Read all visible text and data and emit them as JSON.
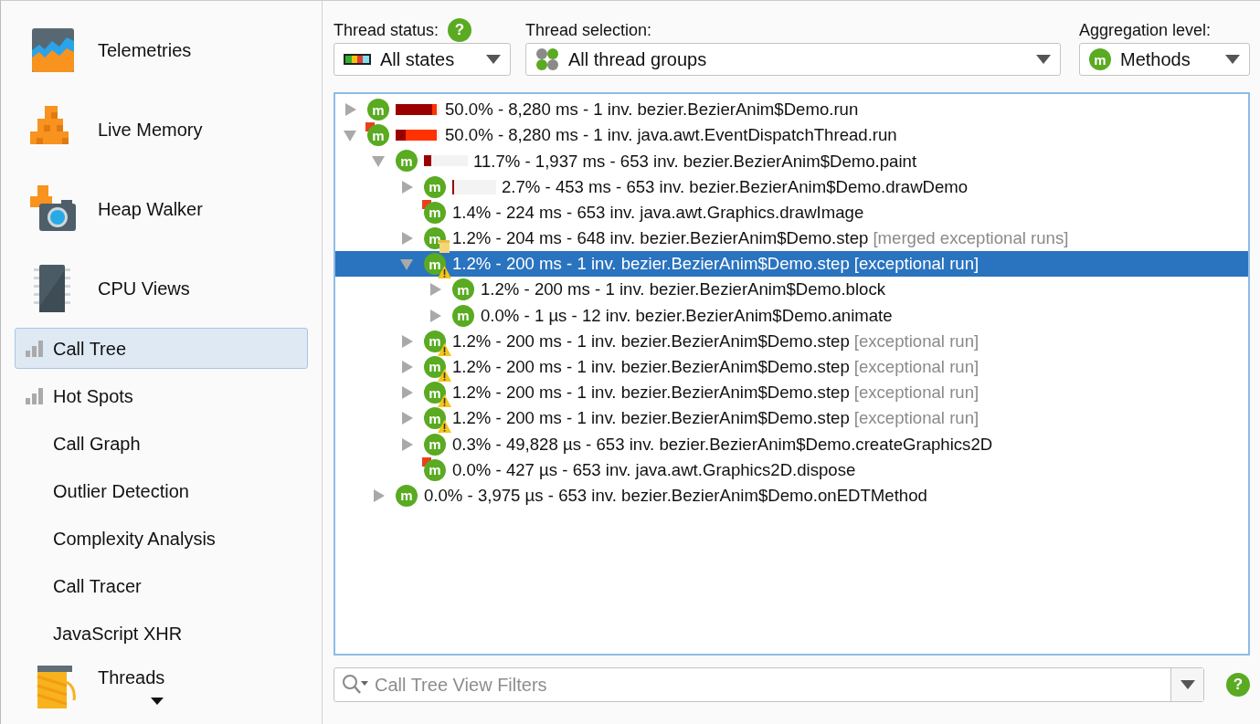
{
  "sidebar": {
    "items": [
      {
        "kind": "tool",
        "label": "Telemetries",
        "selected": false
      },
      {
        "kind": "tool",
        "label": "Live Memory",
        "selected": false
      },
      {
        "kind": "tool",
        "label": "Heap Walker",
        "selected": false
      },
      {
        "kind": "tool",
        "label": "CPU Views",
        "selected": false
      },
      {
        "kind": "ranked",
        "label": "Call Tree",
        "selected": true
      },
      {
        "kind": "ranked",
        "label": "Hot Spots",
        "selected": false
      },
      {
        "kind": "plain",
        "label": "Call Graph",
        "selected": false
      },
      {
        "kind": "plain",
        "label": "Outlier Detection",
        "selected": false
      },
      {
        "kind": "plain",
        "label": "Complexity Analysis",
        "selected": false
      },
      {
        "kind": "plain",
        "label": "Call Tracer",
        "selected": false
      },
      {
        "kind": "plain",
        "label": "JavaScript XHR",
        "selected": false
      },
      {
        "kind": "tool",
        "label": "Threads",
        "selected": false
      }
    ]
  },
  "controls": [
    {
      "kind": "states",
      "label": "Thread status:",
      "help": "?",
      "value": "All states"
    },
    {
      "kind": "groups",
      "label": "Thread selection:",
      "value": "All thread groups"
    },
    {
      "kind": "aggregation",
      "label": "Aggregation level:",
      "icon_text": "m",
      "value": "Methods"
    }
  ],
  "tree": {
    "nodes": [
      {
        "kind": "branch",
        "expanded": false,
        "selected": false,
        "icon_text": "m",
        "filtered": false,
        "warning": false,
        "merged": false,
        "bar": {
          "kind": "mostly-self",
          "level": 0.94
        },
        "text": "50.0% - 8,280 ms - 1 inv. bezier.BezierAnim$Demo.run"
      },
      {
        "kind": "branch",
        "expanded": true,
        "selected": false,
        "icon_text": "m",
        "filtered": true,
        "warning": false,
        "merged": false,
        "bar": {
          "kind": "mostly-callees",
          "level": 0.94
        },
        "text": "50.0% - 8,280 ms - 1 inv. java.awt.EventDispatchThread.run",
        "children": [
          {
            "kind": "branch",
            "expanded": true,
            "selected": false,
            "icon_text": "m",
            "filtered": false,
            "warning": false,
            "merged": false,
            "bar": {
              "kind": "self",
              "level": 0.17
            },
            "text": "11.7% - 1,937 ms - 653 inv. bezier.BezierAnim$Demo.paint",
            "children": [
              {
                "kind": "branch",
                "expanded": false,
                "selected": false,
                "icon_text": "m",
                "filtered": false,
                "warning": false,
                "merged": false,
                "bar": {
                  "kind": "self",
                  "level": 0.05
                },
                "text": "2.7% - 453 ms - 653 inv. bezier.BezierAnim$Demo.drawDemo"
              },
              {
                "kind": "leaf",
                "selected": false,
                "icon_text": "m",
                "filtered": true,
                "warning": false,
                "merged": false,
                "text": "1.4% - 224 ms - 653 inv. java.awt.Graphics.drawImage"
              },
              {
                "kind": "branch",
                "expanded": false,
                "selected": false,
                "icon_text": "m",
                "filtered": false,
                "warning": false,
                "merged": true,
                "text": "1.2% - 204 ms - 648 inv. bezier.BezierAnim$Demo.step",
                "suffix": "[merged exceptional runs]"
              },
              {
                "kind": "branch",
                "expanded": true,
                "selected": true,
                "icon_text": "m",
                "filtered": false,
                "warning": true,
                "merged": false,
                "text": "1.2% - 200 ms - 1 inv. bezier.BezierAnim$Demo.step",
                "suffix": "[exceptional run]",
                "children": [
                  {
                    "kind": "branch",
                    "expanded": false,
                    "selected": false,
                    "icon_text": "m",
                    "filtered": false,
                    "warning": false,
                    "merged": false,
                    "text": "1.2% - 200 ms - 1 inv. bezier.BezierAnim$Demo.block"
                  },
                  {
                    "kind": "branch",
                    "expanded": false,
                    "selected": false,
                    "icon_text": "m",
                    "filtered": false,
                    "warning": false,
                    "merged": false,
                    "text": "0.0% - 1 µs - 12 inv. bezier.BezierAnim$Demo.animate"
                  }
                ]
              },
              {
                "kind": "branch",
                "expanded": false,
                "selected": false,
                "icon_text": "m",
                "filtered": false,
                "warning": true,
                "merged": false,
                "text": "1.2% - 200 ms - 1 inv. bezier.BezierAnim$Demo.step",
                "suffix": "[exceptional run]"
              },
              {
                "kind": "branch",
                "expanded": false,
                "selected": false,
                "icon_text": "m",
                "filtered": false,
                "warning": true,
                "merged": false,
                "text": "1.2% - 200 ms - 1 inv. bezier.BezierAnim$Demo.step",
                "suffix": "[exceptional run]"
              },
              {
                "kind": "branch",
                "expanded": false,
                "selected": false,
                "icon_text": "m",
                "filtered": false,
                "warning": true,
                "merged": false,
                "text": "1.2% - 200 ms - 1 inv. bezier.BezierAnim$Demo.step",
                "suffix": "[exceptional run]"
              },
              {
                "kind": "branch",
                "expanded": false,
                "selected": false,
                "icon_text": "m",
                "filtered": false,
                "warning": true,
                "merged": false,
                "text": "1.2% - 200 ms - 1 inv. bezier.BezierAnim$Demo.step",
                "suffix": "[exceptional run]"
              },
              {
                "kind": "branch",
                "expanded": false,
                "selected": false,
                "icon_text": "m",
                "filtered": false,
                "warning": false,
                "merged": false,
                "text": "0.3% - 49,828 µs - 653 inv. bezier.BezierAnim$Demo.createGraphics2D"
              },
              {
                "kind": "leaf",
                "selected": false,
                "icon_text": "m",
                "filtered": true,
                "warning": false,
                "merged": false,
                "text": "0.0% - 427 µs - 653 inv. java.awt.Graphics2D.dispose"
              }
            ]
          },
          {
            "kind": "branch",
            "expanded": false,
            "selected": false,
            "icon_text": "m",
            "filtered": false,
            "warning": false,
            "merged": false,
            "text": "0.0% - 3,975 µs - 653 inv. bezier.BezierAnim$Demo.onEDTMethod"
          }
        ]
      }
    ]
  },
  "filter": {
    "placeholder": "Call Tree View Filters",
    "help": "?"
  }
}
